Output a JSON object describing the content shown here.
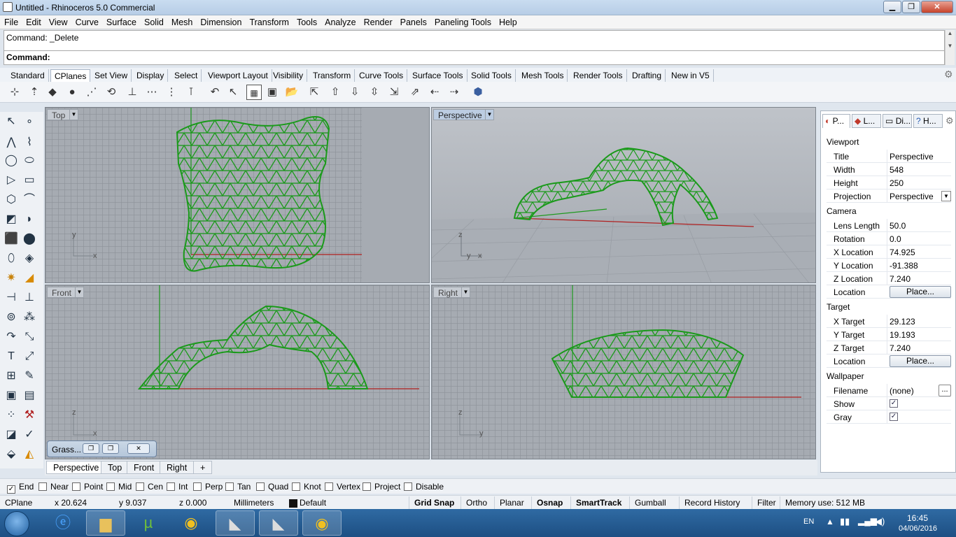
{
  "window": {
    "title": "Untitled - Rhinoceros 5.0 Commercial",
    "min": "▁",
    "max": "❐",
    "close": "✕"
  },
  "menu": [
    "File",
    "Edit",
    "View",
    "Curve",
    "Surface",
    "Solid",
    "Mesh",
    "Dimension",
    "Transform",
    "Tools",
    "Analyze",
    "Render",
    "Panels",
    "Paneling Tools",
    "Help"
  ],
  "command": {
    "history": "Command: _Delete",
    "prompt": "Command:"
  },
  "toolbar_tabs": [
    "Standard",
    "CPlanes",
    "Set View",
    "Display",
    "Select",
    "Viewport Layout",
    "Visibility",
    "Transform",
    "Curve Tools",
    "Surface Tools",
    "Solid Tools",
    "Mesh Tools",
    "Render Tools",
    "Drafting",
    "New in V5"
  ],
  "active_toolbar_tab": "CPlanes",
  "viewports": {
    "top": {
      "label": "Top",
      "axis_y": "y",
      "axis_x": "x"
    },
    "perspective": {
      "label": "Perspective",
      "axis_z": "z",
      "axis_y": "y",
      "axis_x": "x"
    },
    "front": {
      "label": "Front",
      "axis_z": "z",
      "axis_x": "x"
    },
    "right": {
      "label": "Right",
      "axis_z": "z",
      "axis_y": "y"
    },
    "dropdown": "▼"
  },
  "grasshopper": {
    "title": "Grass...",
    "b1": "❐",
    "b2": "❐",
    "b3": "✕"
  },
  "viewport_tabs": [
    "Perspective",
    "Top",
    "Front",
    "Right"
  ],
  "viewport_tabs_add": "+",
  "properties": {
    "tabs": [
      "P...",
      "L...",
      "Di...",
      "H..."
    ],
    "sections": {
      "viewport": "Viewport",
      "camera": "Camera",
      "target": "Target",
      "wallpaper": "Wallpaper"
    },
    "rows": {
      "title": {
        "k": "Title",
        "v": "Perspective"
      },
      "width": {
        "k": "Width",
        "v": "548"
      },
      "height": {
        "k": "Height",
        "v": "250"
      },
      "projection": {
        "k": "Projection",
        "v": "Perspective"
      },
      "lens": {
        "k": "Lens Length",
        "v": "50.0"
      },
      "rotation": {
        "k": "Rotation",
        "v": "0.0"
      },
      "xloc": {
        "k": "X Location",
        "v": "74.925"
      },
      "yloc": {
        "k": "Y Location",
        "v": "-91.388"
      },
      "zloc": {
        "k": "Z Location",
        "v": "7.240"
      },
      "camloc": {
        "k": "Location",
        "v": "Place..."
      },
      "xt": {
        "k": "X Target",
        "v": "29.123"
      },
      "yt": {
        "k": "Y Target",
        "v": "19.193"
      },
      "zt": {
        "k": "Z Target",
        "v": "7.240"
      },
      "tloc": {
        "k": "Location",
        "v": "Place..."
      },
      "file": {
        "k": "Filename",
        "v": "(none)",
        "btn": "..."
      },
      "show": {
        "k": "Show",
        "v": "✓"
      },
      "gray": {
        "k": "Gray",
        "v": "✓"
      }
    }
  },
  "osnaps": [
    {
      "label": "End",
      "checked": "✓"
    },
    {
      "label": "Near",
      "checked": ""
    },
    {
      "label": "Point",
      "checked": ""
    },
    {
      "label": "Mid",
      "checked": ""
    },
    {
      "label": "Cen",
      "checked": ""
    },
    {
      "label": "Int",
      "checked": ""
    },
    {
      "label": "Perp",
      "checked": ""
    },
    {
      "label": "Tan",
      "checked": ""
    },
    {
      "label": "Quad",
      "checked": ""
    },
    {
      "label": "Knot",
      "checked": ""
    },
    {
      "label": "Vertex",
      "checked": ""
    },
    {
      "label": "Project",
      "checked": ""
    },
    {
      "label": "Disable",
      "checked": ""
    }
  ],
  "status": {
    "cplane": "CPlane",
    "x": "x 20.624",
    "y": "y 9.037",
    "z": "z 0.000",
    "units": "Millimeters",
    "layer": "Default",
    "buttons": [
      "Grid Snap",
      "Ortho",
      "Planar",
      "Osnap",
      "SmartTrack",
      "Gumball",
      "Record History",
      "Filter"
    ],
    "memory": "Memory use: 512 MB"
  },
  "taskbar": {
    "lang": "EN",
    "time": "16:45",
    "date": "04/06/2016"
  },
  "colors": {
    "mesh": "#1a9a1a",
    "x_axis": "#b02020",
    "y_axis": "#1f9a1f"
  }
}
